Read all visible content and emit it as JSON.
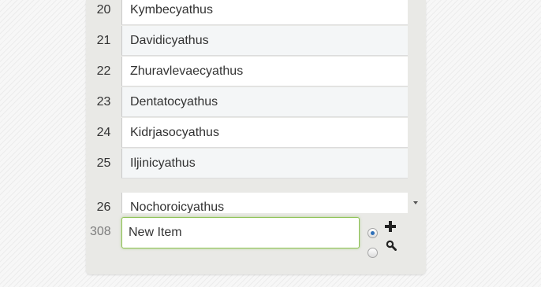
{
  "list": {
    "rows": [
      {
        "num": "20",
        "name": "Kymbecyathus"
      },
      {
        "num": "21",
        "name": "Davidicyathus"
      },
      {
        "num": "22",
        "name": "Zhuravlevaecyathus"
      },
      {
        "num": "23",
        "name": "Dentatocyathus"
      },
      {
        "num": "24",
        "name": "Kidrjasocyathus"
      },
      {
        "num": "25",
        "name": "Iljinicyathus"
      },
      {
        "num": "26",
        "name": "Nochoroicyathus"
      }
    ]
  },
  "footer": {
    "count": "308",
    "input_value": "New Item",
    "add_icon": "plus-icon",
    "search_icon": "search-icon"
  },
  "colors": {
    "input_focus": "#8cc152",
    "radio_selected": "#2e6fb8"
  }
}
